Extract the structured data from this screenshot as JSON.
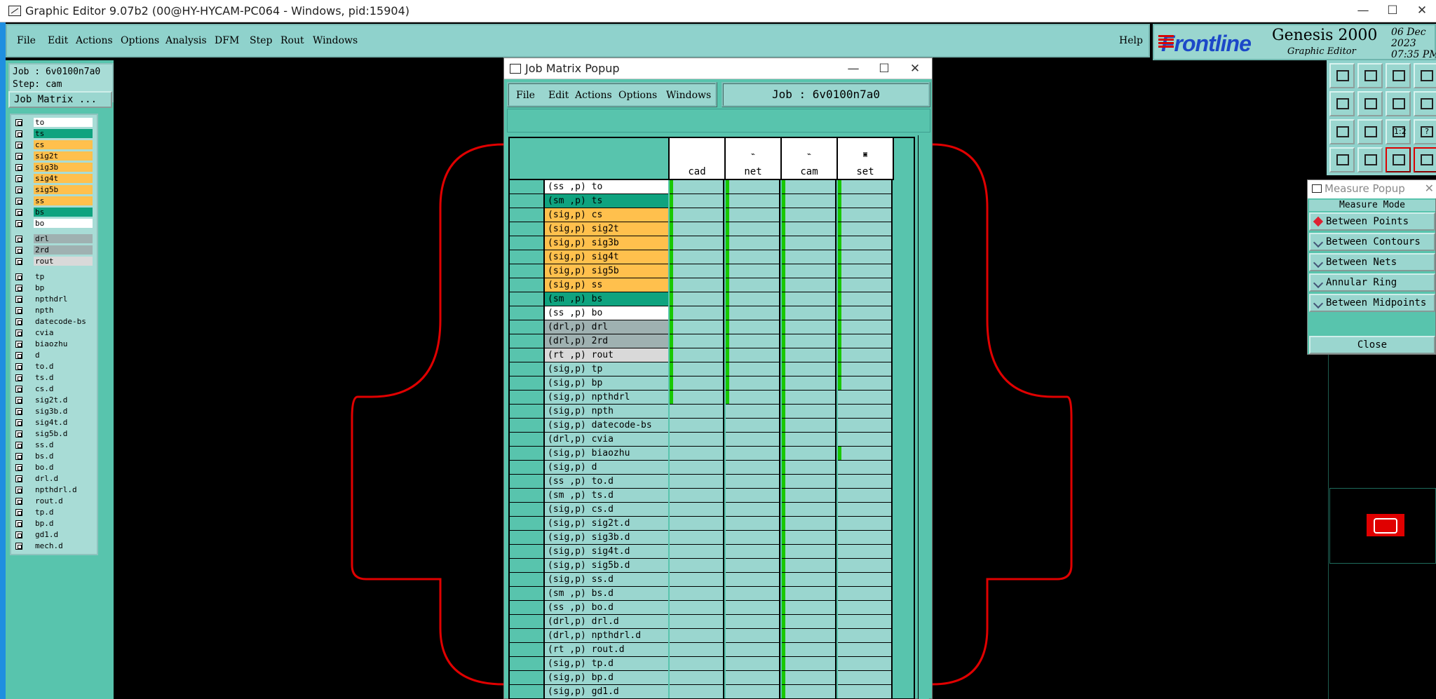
{
  "window": {
    "title": "Graphic Editor 9.07b2 (00@HY-HYCAM-PC064 - Windows, pid:15904)",
    "minimize": "—",
    "maximize": "☐",
    "close": "✕"
  },
  "menubar": {
    "items": [
      "File",
      "Edit",
      "Actions",
      "Options",
      "Analysis",
      "DFM",
      "Step",
      "Rout",
      "Windows"
    ],
    "help": "Help"
  },
  "logo": {
    "brand": "Frontline",
    "product": "Genesis 2000",
    "date": "06 Dec 2023",
    "time": "07:35 PM",
    "subtitle": "Graphic Editor"
  },
  "left": {
    "job": "Job : 6v0100n7a0",
    "step": "Step: cam",
    "job_matrix_button": "Job Matrix ...",
    "layers": [
      {
        "name": "to",
        "color": "#ffffff"
      },
      {
        "name": "ts",
        "color": "#0fa37f"
      },
      {
        "name": "cs",
        "color": "#ffc04d"
      },
      {
        "name": "sig2t",
        "color": "#ffc04d"
      },
      {
        "name": "sig3b",
        "color": "#ffc04d"
      },
      {
        "name": "sig4t",
        "color": "#ffc04d"
      },
      {
        "name": "sig5b",
        "color": "#ffc04d"
      },
      {
        "name": "ss",
        "color": "#ffc04d"
      },
      {
        "name": "bs",
        "color": "#0fa37f"
      },
      {
        "name": "bo",
        "color": "#ffffff"
      },
      {
        "name": "drl",
        "color": "#9fb1b1"
      },
      {
        "name": "2rd",
        "color": "#9fb1b1"
      },
      {
        "name": "rout",
        "color": "#d9d9d9"
      },
      {
        "name": "tp",
        "color": "#a8dcd6"
      },
      {
        "name": "bp",
        "color": "#a8dcd6"
      },
      {
        "name": "npthdrl",
        "color": "#a8dcd6"
      },
      {
        "name": "npth",
        "color": "#a8dcd6"
      },
      {
        "name": "datecode-bs",
        "color": "#a8dcd6"
      },
      {
        "name": "cvia",
        "color": "#a8dcd6"
      },
      {
        "name": "biaozhu",
        "color": "#a8dcd6"
      },
      {
        "name": "d",
        "color": "#a8dcd6"
      },
      {
        "name": "to.d",
        "color": "#a8dcd6"
      },
      {
        "name": "ts.d",
        "color": "#a8dcd6"
      },
      {
        "name": "cs.d",
        "color": "#a8dcd6"
      },
      {
        "name": "sig2t.d",
        "color": "#a8dcd6"
      },
      {
        "name": "sig3b.d",
        "color": "#a8dcd6"
      },
      {
        "name": "sig4t.d",
        "color": "#a8dcd6"
      },
      {
        "name": "sig5b.d",
        "color": "#a8dcd6"
      },
      {
        "name": "ss.d",
        "color": "#a8dcd6"
      },
      {
        "name": "bs.d",
        "color": "#a8dcd6"
      },
      {
        "name": "bo.d",
        "color": "#a8dcd6"
      },
      {
        "name": "drl.d",
        "color": "#a8dcd6"
      },
      {
        "name": "npthdrl.d",
        "color": "#a8dcd6"
      },
      {
        "name": "rout.d",
        "color": "#a8dcd6"
      },
      {
        "name": "tp.d",
        "color": "#a8dcd6"
      },
      {
        "name": "bp.d",
        "color": "#a8dcd6"
      },
      {
        "name": "gd1.d",
        "color": "#a8dcd6"
      },
      {
        "name": "mech.d",
        "color": "#a8dcd6"
      }
    ]
  },
  "job_matrix": {
    "title": "Job Matrix Popup",
    "menus": [
      "File",
      "Edit",
      "Actions",
      "Options",
      "Windows"
    ],
    "job_label": "Job : 6v0100n7a0",
    "columns": [
      "cad",
      "net",
      "cam",
      "set"
    ],
    "rows": [
      {
        "label": "(ss ,p) to",
        "color": "#ffffff"
      },
      {
        "label": "(sm ,p) ts",
        "color": "#0fa37f"
      },
      {
        "label": "(sig,p) cs",
        "color": "#ffc04d"
      },
      {
        "label": "(sig,p) sig2t",
        "color": "#ffc04d"
      },
      {
        "label": "(sig,p) sig3b",
        "color": "#ffc04d"
      },
      {
        "label": "(sig,p) sig4t",
        "color": "#ffc04d"
      },
      {
        "label": "(sig,p) sig5b",
        "color": "#ffc04d"
      },
      {
        "label": "(sig,p) ss",
        "color": "#ffc04d"
      },
      {
        "label": "(sm ,p) bs",
        "color": "#0fa37f"
      },
      {
        "label": "(ss ,p) bo",
        "color": "#ffffff"
      },
      {
        "label": "(drl,p) drl",
        "color": "#9fb1b1"
      },
      {
        "label": "(drl,p) 2rd",
        "color": "#9fb1b1"
      },
      {
        "label": "(rt ,p) rout",
        "color": "#d9d9d9"
      },
      {
        "label": "(sig,p) tp",
        "color": "#9ad6cf"
      },
      {
        "label": "(sig,p) bp",
        "color": "#9ad6cf"
      },
      {
        "label": "(sig,p) npthdrl",
        "color": "#9ad6cf"
      },
      {
        "label": "(sig,p) npth",
        "color": "#9ad6cf"
      },
      {
        "label": "(sig,p) datecode-bs",
        "color": "#9ad6cf"
      },
      {
        "label": "(drl,p) cvia",
        "color": "#9ad6cf"
      },
      {
        "label": "(sig,p) biaozhu",
        "color": "#9ad6cf"
      },
      {
        "label": "(sig,p) d",
        "color": "#9ad6cf"
      },
      {
        "label": "(ss ,p) to.d",
        "color": "#9ad6cf"
      },
      {
        "label": "(sm ,p) ts.d",
        "color": "#9ad6cf"
      },
      {
        "label": "(sig,p) cs.d",
        "color": "#9ad6cf"
      },
      {
        "label": "(sig,p) sig2t.d",
        "color": "#9ad6cf"
      },
      {
        "label": "(sig,p) sig3b.d",
        "color": "#9ad6cf"
      },
      {
        "label": "(sig,p) sig4t.d",
        "color": "#9ad6cf"
      },
      {
        "label": "(sig,p) sig5b.d",
        "color": "#9ad6cf"
      },
      {
        "label": "(sig,p) ss.d",
        "color": "#9ad6cf"
      },
      {
        "label": "(sm ,p) bs.d",
        "color": "#9ad6cf"
      },
      {
        "label": "(ss ,p) bo.d",
        "color": "#9ad6cf"
      },
      {
        "label": "(drl,p) drl.d",
        "color": "#9ad6cf"
      },
      {
        "label": "(drl,p) npthdrl.d",
        "color": "#9ad6cf"
      },
      {
        "label": "(rt ,p) rout.d",
        "color": "#9ad6cf"
      },
      {
        "label": "(sig,p) tp.d",
        "color": "#9ad6cf"
      },
      {
        "label": "(sig,p) bp.d",
        "color": "#9ad6cf"
      },
      {
        "label": "(sig,p) gd1.d",
        "color": "#9ad6cf"
      }
    ]
  },
  "measure": {
    "title": "Measure Popup",
    "mode_label": "Measure Mode",
    "options": [
      "Between Points",
      "Between Contours",
      "Between Nets",
      "Annular Ring",
      "Between Midpoints"
    ],
    "selected": "Between Points",
    "close": "Close"
  },
  "toolbar_icons": [
    "zoom-home-icon",
    "zoom-fit-icon",
    "layer-icon",
    "grid-icon",
    "pan-left-icon",
    "pan-right-icon",
    "undo-icon",
    "split-icon",
    "fit-icon",
    "center-icon",
    "ratio-icon",
    "help-icon",
    "snap-icon",
    "measure-icon",
    "matrix-icon",
    "settings-icon"
  ],
  "toolbar_labels": [
    "",
    "",
    "",
    "",
    "",
    "",
    "",
    "",
    "",
    "",
    "1:2",
    "?",
    "",
    "",
    "",
    ""
  ]
}
